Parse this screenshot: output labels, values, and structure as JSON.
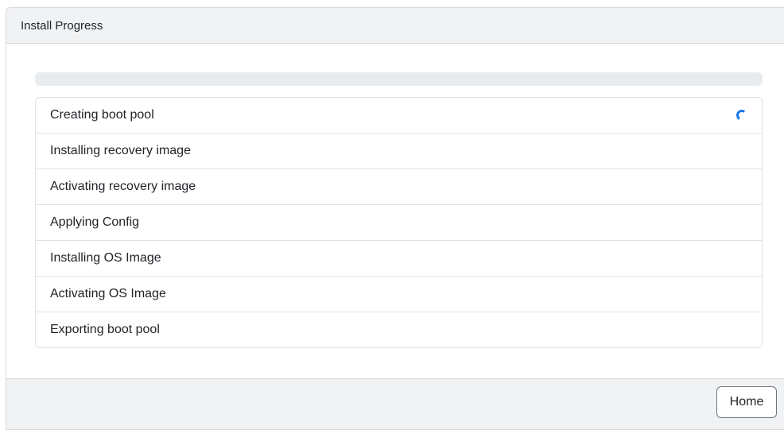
{
  "header": {
    "title": "Install Progress"
  },
  "progress": {
    "percent": 0,
    "track_color": "#e9ecef",
    "fill_color": "#0d6efd"
  },
  "steps": [
    {
      "label": "Creating boot pool",
      "status": "in-progress"
    },
    {
      "label": "Installing recovery image",
      "status": "pending"
    },
    {
      "label": "Activating recovery image",
      "status": "pending"
    },
    {
      "label": "Applying Config",
      "status": "pending"
    },
    {
      "label": "Installing OS Image",
      "status": "pending"
    },
    {
      "label": "Activating OS Image",
      "status": "pending"
    },
    {
      "label": "Exporting boot pool",
      "status": "pending"
    }
  ],
  "spinner": {
    "icon": "loading-spinner-icon",
    "color": "#1a73e8"
  },
  "footer": {
    "home_label": "Home"
  }
}
